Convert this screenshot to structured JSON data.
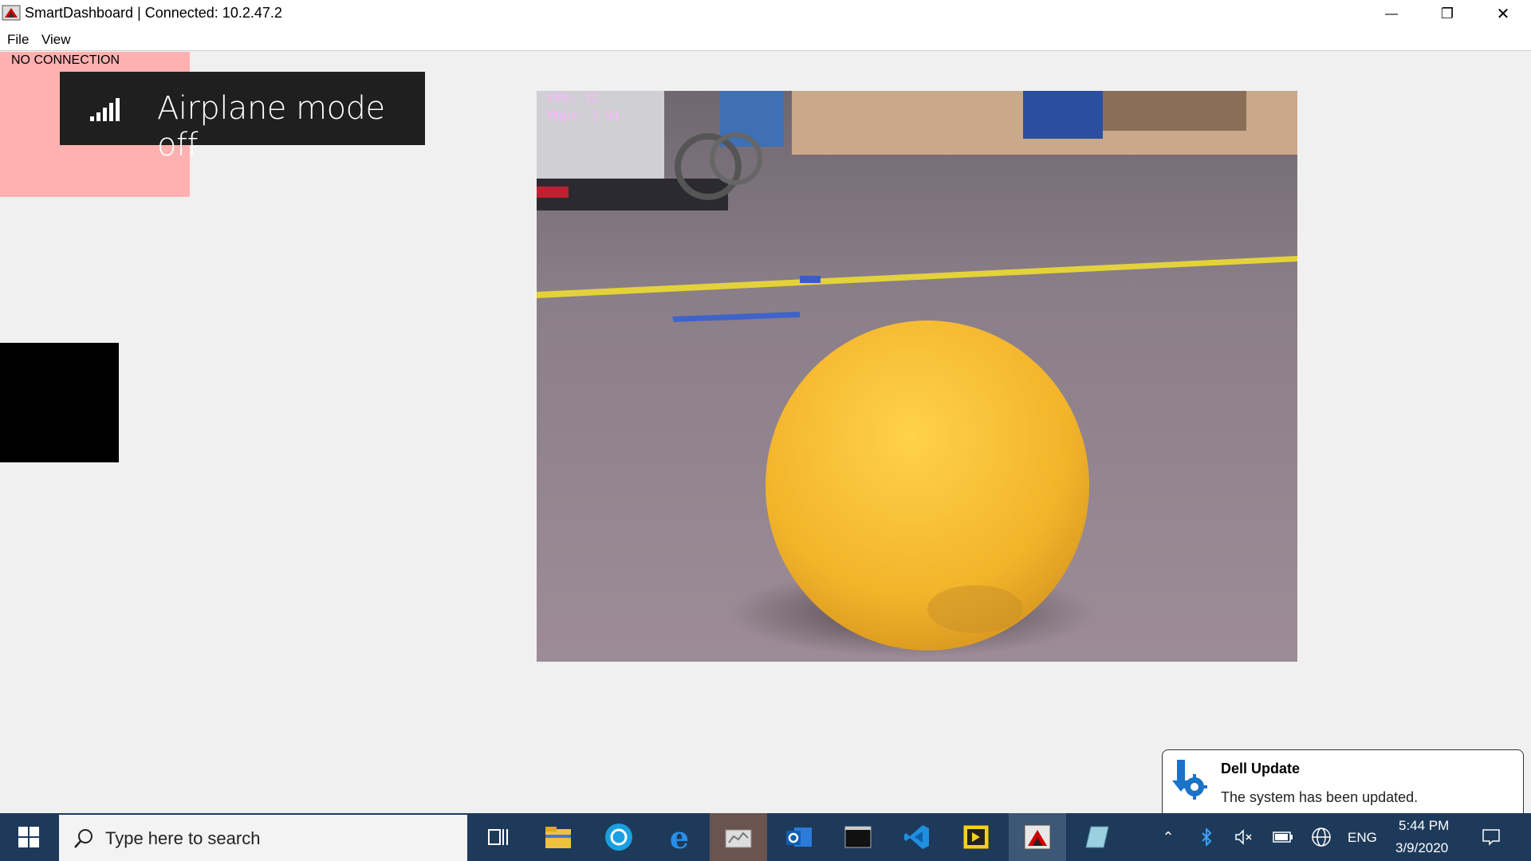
{
  "window": {
    "title": "SmartDashboard | Connected: 10.2.47.2",
    "minimize_glyph": "—",
    "maximize_glyph": "❐",
    "close_glyph": "✕"
  },
  "menu": {
    "items": [
      "File",
      "View"
    ]
  },
  "status": {
    "no_connection": "NO CONNECTION"
  },
  "toast": {
    "icon": "signal-bars-icon",
    "text": "Airplane mode off"
  },
  "camera": {
    "fps_label": "FPS: 11",
    "mbps_label": "Mbps: 1.91"
  },
  "notification": {
    "icon": "dell-update-icon",
    "title": "Dell Update",
    "body": "The system has been updated."
  },
  "taskbar": {
    "search_placeholder": "Type here to search",
    "apps": [
      "start-icon",
      "task-view-icon",
      "file-explorer-icon",
      "camera-app-icon",
      "edge-icon",
      "dashboard-app-icon",
      "outlook-icon",
      "terminal-icon",
      "vscode-icon",
      "labview-icon",
      "smartdashboard-icon",
      "notes-app-icon"
    ],
    "tray": {
      "language": "ENG",
      "time": "5:44 PM",
      "date": "3/9/2020"
    }
  },
  "colors": {
    "taskbar": "#1e3a5a",
    "no_connection_bg": "#ffb1b1",
    "toast_bg": "#1f1f1f",
    "ball": "#f2b72a"
  }
}
